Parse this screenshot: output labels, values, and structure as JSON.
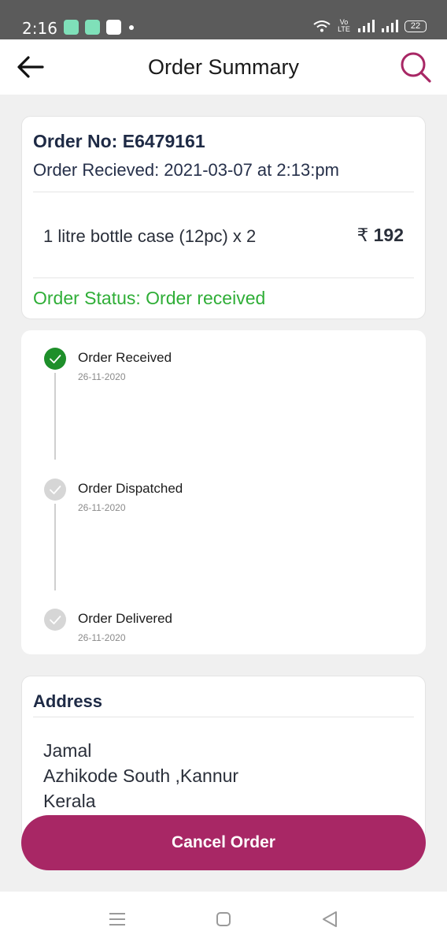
{
  "status_bar": {
    "time": "2:16",
    "network_label": "Vo LTE",
    "battery": "22"
  },
  "app_bar": {
    "title": "Order Summary",
    "back_icon": "arrow-left-icon",
    "search_icon": "search-icon"
  },
  "order": {
    "number_label": "Order No: E6479161",
    "received_label": "Order Recieved: 2021-03-07 at 2:13:pm",
    "item": "1 litre bottle  case (12pc) x 2",
    "currency": "₹",
    "price": "192",
    "status_label": "Order Status: Order received"
  },
  "tracking": {
    "steps": [
      {
        "title": "Order Received",
        "date": "26-11-2020",
        "state": "done"
      },
      {
        "title": "Order Dispatched",
        "date": "26-11-2020",
        "state": "pending"
      },
      {
        "title": "Order Delivered",
        "date": "26-11-2020",
        "state": "pending"
      }
    ]
  },
  "address": {
    "title": "Address",
    "lines": [
      "Jamal",
      "Azhikode South ,Kannur",
      "Kerala"
    ]
  },
  "actions": {
    "cancel_label": "Cancel Order"
  },
  "colors": {
    "brand": "#a82765",
    "status_green": "#2fae37",
    "step_done": "#1e8f2a"
  }
}
